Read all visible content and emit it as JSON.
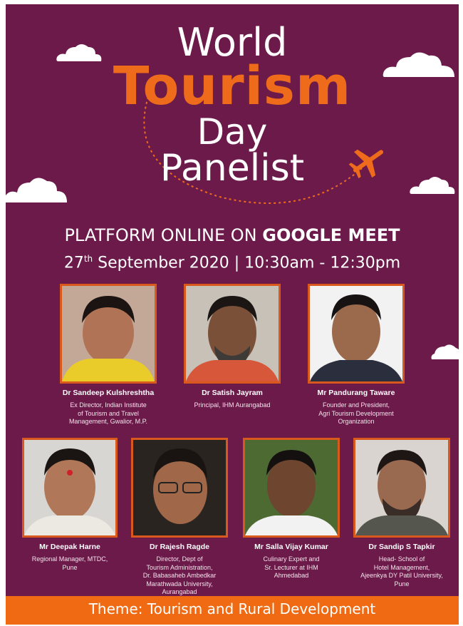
{
  "colors": {
    "background": "#6b1a4a",
    "accent": "#ef6b1c",
    "text": "#ffffff",
    "theme_bar": "#ef6a12"
  },
  "title": {
    "line1": "World",
    "line2": "Tourism",
    "line3": "Day",
    "line4": "Panelist"
  },
  "icons": [
    "cloud-icon",
    "airplane-icon"
  ],
  "platform": {
    "prefix": "PLATFORM ONLINE ON ",
    "highlight": "GOOGLE MEET"
  },
  "date": {
    "day": "27",
    "suffix": "th",
    "rest": " September 2020 | 10:30am - 12:30pm"
  },
  "panelists": [
    {
      "name": "Dr Sandeep Kulshreshtha",
      "desc": "Ex Director, Indian Institute\nof Tourism and Travel\nManagement, Gwalior, M.P."
    },
    {
      "name": "Dr Satish Jayram",
      "desc": "Principal, IHM Aurangabad"
    },
    {
      "name": "Mr Pandurang Taware",
      "desc": "Founder and President,\nAgri Tourism Development\nOrganization"
    },
    {
      "name": "Mr Deepak Harne",
      "desc": "Regional Manager, MTDC,\nPune"
    },
    {
      "name": "Dr Rajesh Ragde",
      "desc": "Director, Dept of\nTourism Administration,\nDr. Babasaheb Ambedkar\nMarathwada University,\nAurangabad"
    },
    {
      "name": "Mr Salla Vijay Kumar",
      "desc": "Culinary Expert and\nSr. Lecturer at IHM\nAhmedabad"
    },
    {
      "name": "Dr Sandip S Tapkir",
      "desc": "Head- School of\nHotel Management,\nAjeenkya DY Patil University,\nPune"
    }
  ],
  "theme": "Theme: Tourism and Rural Development"
}
